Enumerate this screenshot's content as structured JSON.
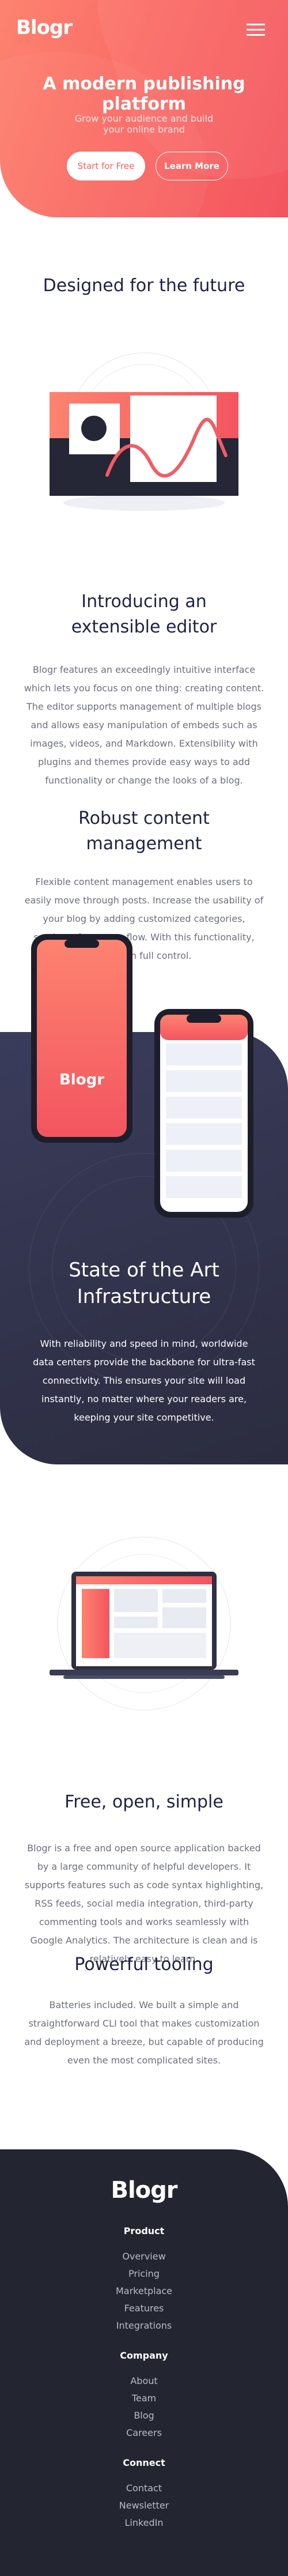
{
  "brand": {
    "logo": "Blogr",
    "primary": "#fa6c66",
    "dark": "#232530",
    "heading": "#1f2245"
  },
  "header": {
    "menu_icon": "hamburger-menu-icon",
    "title": "A modern publishing platform",
    "subtitle": "Grow your audience and build your online brand",
    "cta_primary": "Start for Free",
    "cta_secondary": "Learn More"
  },
  "section_future": {
    "title": "Designed for the future",
    "intro_title": "Introducing an extensible editor",
    "intro_body": "Blogr features an exceedingly intuitive interface which lets you focus on one thing: creating content. The editor supports management of multiple blogs and allows easy manipulation of embeds such as images, videos, and Markdown. Extensibility with plugins and themes provide easy ways to add functionality or change the looks of a blog.",
    "robust_title": "Robust content management",
    "robust_body": "Flexible content management enables users to easily move through posts. Increase the usability of your blog by adding customized categories, sections, format, or flow. With this functionality, you're in full control."
  },
  "phone_mockup": {
    "screen_logo": "Blogr"
  },
  "section_infra": {
    "title": "State of the Art Infrastructure",
    "body": "With reliability and speed in mind, worldwide data centers provide the backbone for ultra-fast connectivity. This ensures your site will load instantly, no matter where your readers are, keeping your site competitive."
  },
  "section_features": {
    "free_title": "Free, open, simple",
    "free_body": "Blogr is a free and open source application backed by a large community of helpful developers. It supports features such as code syntax highlighting, RSS feeds, social media integration, third-party commenting tools and works seamlessly with Google Analytics. The architecture is clean and is relatively easy to learn.",
    "tooling_title": "Powerful tooling",
    "tooling_body": "Batteries included. We built a simple and straightforward CLI tool that makes customization and deployment a breeze, but capable of producing even the most complicated sites."
  },
  "footer": {
    "logo": "Blogr",
    "columns": [
      {
        "heading": "Product",
        "links": [
          "Overview",
          "Pricing",
          "Marketplace",
          "Features",
          "Integrations"
        ]
      },
      {
        "heading": "Company",
        "links": [
          "About",
          "Team",
          "Blog",
          "Careers"
        ]
      },
      {
        "heading": "Connect",
        "links": [
          "Contact",
          "Newsletter",
          "LinkedIn"
        ]
      }
    ]
  }
}
